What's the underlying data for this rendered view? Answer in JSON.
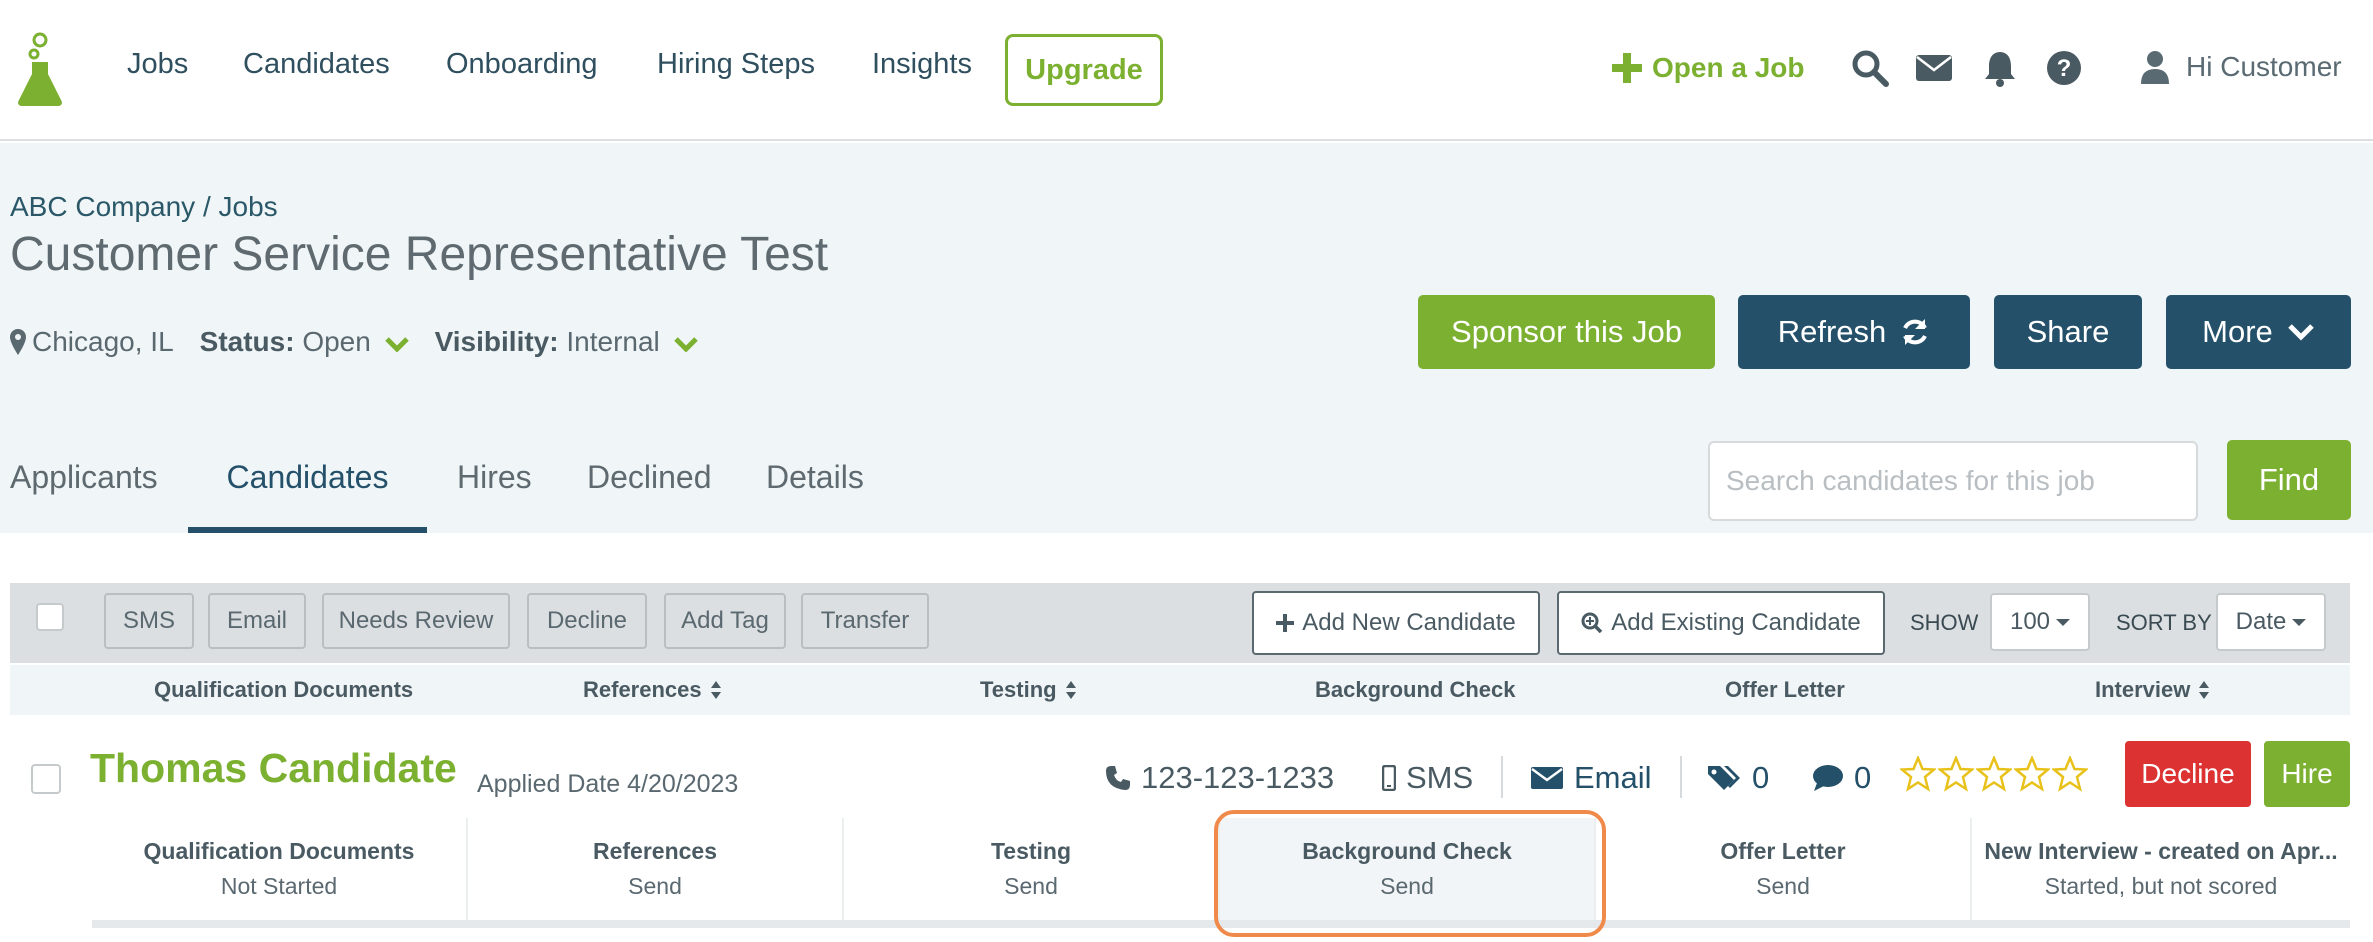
{
  "nav": {
    "links": [
      "Jobs",
      "Candidates",
      "Onboarding",
      "Hiring Steps",
      "Insights"
    ],
    "upgrade": "Upgrade",
    "open_job": "Open a Job",
    "greeting": "Hi Customer",
    "accent": "#7cb031"
  },
  "job": {
    "breadcrumb": "ABC Company / Jobs",
    "title": "Customer Service Representative Test",
    "location": "Chicago, IL",
    "status_label": "Status:",
    "status_value": "Open",
    "visibility_label": "Visibility:",
    "visibility_value": "Internal"
  },
  "actions": {
    "sponsor": "Sponsor this Job",
    "refresh": "Refresh",
    "share": "Share",
    "more": "More"
  },
  "tabs": [
    "Applicants",
    "Candidates",
    "Hires",
    "Declined",
    "Details"
  ],
  "active_tab": "Candidates",
  "search": {
    "placeholder": "Search candidates for this job",
    "find": "Find"
  },
  "toolbar": {
    "bulk": [
      "SMS",
      "Email",
      "Needs Review",
      "Decline",
      "Add Tag",
      "Transfer"
    ],
    "add_new": "Add New Candidate",
    "add_existing": "Add Existing Candidate",
    "show_label": "SHOW",
    "show_value": "100",
    "sort_label": "SORT BY",
    "sort_value": "Date"
  },
  "columns": [
    "Qualification Documents",
    "References",
    "Testing",
    "Background Check",
    "Offer Letter",
    "Interview"
  ],
  "candidate": {
    "name": "Thomas Candidate",
    "applied": "Applied Date 4/20/2023",
    "phone": "123-123-1233",
    "sms": "SMS",
    "email": "Email",
    "tags": "0",
    "comments": "0",
    "rating": 0,
    "decline": "Decline",
    "hire": "Hire",
    "steps": [
      {
        "title": "Qualification Documents",
        "status": "Not Started"
      },
      {
        "title": "References",
        "status": "Send"
      },
      {
        "title": "Testing",
        "status": "Send"
      },
      {
        "title": "Background Check",
        "status": "Send"
      },
      {
        "title": "Offer Letter",
        "status": "Send"
      },
      {
        "title": "New Interview - created on Apr...",
        "status": "Started, but not scored"
      }
    ]
  }
}
